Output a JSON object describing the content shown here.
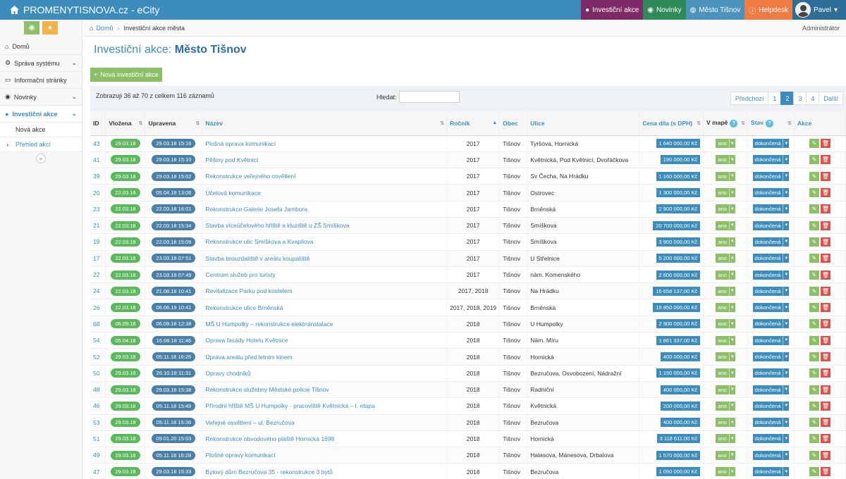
{
  "app": {
    "title": "PROMENYTISNOVA.cz - eCity"
  },
  "topnav": {
    "investicni": "Investiční akce",
    "novinky": "Novinky",
    "mesto": "Město Tišnov",
    "helpdesk": "Helpdesk",
    "user": "Pavel"
  },
  "breadcrumb": {
    "home": "Domů",
    "current": "Investiční akce města",
    "role": "Administrátor"
  },
  "sidebar": {
    "items": [
      {
        "label": "Domů",
        "icon": "home-icon"
      },
      {
        "label": "Správa systému",
        "icon": "gears-icon"
      },
      {
        "label": "Informační stránky",
        "icon": "monitor-icon"
      },
      {
        "label": "Novinky",
        "icon": "rss-icon"
      },
      {
        "label": "Investiční akce",
        "icon": "map-marker-icon"
      }
    ],
    "subitems": [
      "Nová akce",
      "Přehled akcí"
    ]
  },
  "page": {
    "title_prefix": "Investiční akce:",
    "title_city": "Město Tišnov",
    "add_button": "Nová investiční akce"
  },
  "table_controls": {
    "info": "Zobrazuji 36 až 70 z celkem 116 záznamů",
    "search_label": "Hledat:",
    "search_value": "",
    "pager": {
      "prev": "Předchozí",
      "pages": [
        "1",
        "2",
        "3",
        "4"
      ],
      "current": "2",
      "next": "Další"
    }
  },
  "columns": [
    "ID",
    "Vložena",
    "Upravena",
    "Název",
    "Ročník",
    "Obec",
    "Ulice",
    "Cena díla (s DPH)",
    "V mapě",
    "Stav",
    "Akce"
  ],
  "rows": [
    {
      "id": "43",
      "vlozena": "29.03.18",
      "upravena": "29.03.18 15:16",
      "nazev": "Plošná oprava komunikací",
      "rocnik": "2017",
      "obec": "Tišnov",
      "ulice": "Tyršova, Hornická",
      "cena": "1 640 000,00 Kč",
      "mapa": "ano",
      "stav": "dokončená"
    },
    {
      "id": "41",
      "vlozena": "29.03.18",
      "upravena": "29.03.18 15:10",
      "nazev": "Pěšiny pod Květnicí",
      "rocnik": "2017",
      "obec": "Tišnov",
      "ulice": "Květnická, Pod Květnicí, Dvořáčkova",
      "cena": "190 000,00 Kč",
      "mapa": "ano",
      "stav": "dokončená"
    },
    {
      "id": "39",
      "vlozena": "29.03.18",
      "upravena": "29.03.18 15:02",
      "nazev": "Rekonstrukce veřejného osvětlení",
      "rocnik": "2017",
      "obec": "Tišnov",
      "ulice": "Sv Čecha, Na Hrádku",
      "cena": "1 160 000,00 Kč",
      "mapa": "ano",
      "stav": "dokončená"
    },
    {
      "id": "20",
      "vlozena": "22.03.18",
      "upravena": "05.04.18 13:06",
      "nazev": "Účelová komunikace",
      "rocnik": "2017",
      "obec": "Tišnov",
      "ulice": "Ostrovec",
      "cena": "1 300 000,00 Kč",
      "mapa": "ano",
      "stav": "dokončená"
    },
    {
      "id": "23",
      "vlozena": "22.03.18",
      "upravena": "22.03.18 16:01",
      "nazev": "Rekonstrukce Galerie Josefa Jambora",
      "rocnik": "2017",
      "obec": "Tišnov",
      "ulice": "Brněnská",
      "cena": "2 900 000,00 Kč",
      "mapa": "ano",
      "stav": "dokončená"
    },
    {
      "id": "21",
      "vlozena": "22.03.18",
      "upravena": "22.03.18 15:34",
      "nazev": "Stavba víceúčelového hřiště a kluziště u ZŠ Smíškova",
      "rocnik": "2017",
      "obec": "Tišnov",
      "ulice": "Smíškova",
      "cena": "20 700 000,00 Kč",
      "mapa": "ano",
      "stav": "dokončená"
    },
    {
      "id": "19",
      "vlozena": "22.03.18",
      "upravena": "22.03.18 15:09",
      "nazev": "Rekonstrukce ulic Smíškova a Kvapilova",
      "rocnik": "2017",
      "obec": "Tišnov",
      "ulice": "Smíškova",
      "cena": "3 900 000,00 Kč",
      "mapa": "ano",
      "stav": "dokončená"
    },
    {
      "id": "17",
      "vlozena": "22.03.18",
      "upravena": "23.03.18 07:51",
      "nazev": "Stavba brouzdaliště v areálu koupaliště",
      "rocnik": "2017",
      "obec": "Tišnov",
      "ulice": "U Střelnice",
      "cena": "5 200 000,00 Kč",
      "mapa": "ano",
      "stav": "dokončená"
    },
    {
      "id": "22",
      "vlozena": "22.03.18",
      "upravena": "23.03.18 07:49",
      "nazev": "Centrum služeb pro turisty",
      "rocnik": "2017",
      "obec": "Tišnov",
      "ulice": "nám. Komenského",
      "cena": "2 600 000,00 Kč",
      "mapa": "ano",
      "stav": "dokončená"
    },
    {
      "id": "24",
      "vlozena": "22.03.18",
      "upravena": "21.08.18 10:41",
      "nazev": "Revitalizace Parku pod kostelem",
      "rocnik": "2017, 2018",
      "obec": "Tišnov",
      "ulice": "Na Hrádku",
      "cena": "15 658 137,00 Kč",
      "mapa": "ano",
      "stav": "dokončená"
    },
    {
      "id": "26",
      "vlozena": "22.03.18",
      "upravena": "06.06.19 10:41",
      "nazev": "Rekonstrukce ulice Brněnská",
      "rocnik": "2017, 2018, 2019",
      "obec": "Tišnov",
      "ulice": "Brněnská",
      "cena": "19 850 000,00 Kč",
      "mapa": "ano",
      "stav": "dokončená"
    },
    {
      "id": "68",
      "vlozena": "06.09.18",
      "upravena": "06.09.18 12:38",
      "nazev": "MŠ U Humpolky – rekonstrukce elektroinstalace",
      "rocnik": "2018",
      "obec": "Tišnov",
      "ulice": "U Humpolky",
      "cena": "2 900 000,00 Kč",
      "mapa": "ano",
      "stav": "dokončená"
    },
    {
      "id": "54",
      "vlozena": "05.04.18",
      "upravena": "16.08.18 11:46",
      "nazev": "Oprava fasády Hotelu Květnice",
      "rocnik": "2018",
      "obec": "Tišnov",
      "ulice": "Nám. Míru",
      "cena": "1 861 337,00 Kč",
      "mapa": "ano",
      "stav": "dokončená"
    },
    {
      "id": "52",
      "vlozena": "29.03.18",
      "upravena": "05.11.18 16:26",
      "nazev": "Úprava areálu před letním kinem",
      "rocnik": "2018",
      "obec": "Tišnov",
      "ulice": "Hornická",
      "cena": "400 000,00 Kč",
      "mapa": "ano",
      "stav": "dokončená"
    },
    {
      "id": "50",
      "vlozena": "29.03.18",
      "upravena": "26.10.18 11:31",
      "nazev": "Opravy chodníků",
      "rocnik": "2018",
      "obec": "Tišnov",
      "ulice": "Bezručova, Osvobození, Nádražní",
      "cena": "1 150 000,00 Kč",
      "mapa": "ano",
      "stav": "dokončená"
    },
    {
      "id": "48",
      "vlozena": "29.03.18",
      "upravena": "29.03.18 15:38",
      "nazev": "Rekonstrukce služebny Městské policie Tišnov",
      "rocnik": "2018",
      "obec": "Tišnov",
      "ulice": "Radniční",
      "cena": "400 000,00 Kč",
      "mapa": "ano",
      "stav": "dokončená"
    },
    {
      "id": "46",
      "vlozena": "29.03.18",
      "upravena": "05.11.18 15:49",
      "nazev": "Přírodní hřiště MŠ U Humpolky - pracoviště Květnická – I. etapa",
      "rocnik": "2018",
      "obec": "Tišnov",
      "ulice": "Květnická",
      "cena": "200 000,00 Kč",
      "mapa": "ano",
      "stav": "dokončená"
    },
    {
      "id": "53",
      "vlozena": "29.03.18",
      "upravena": "05.11.18 15:38",
      "nazev": "Veřejné osvětlení – ul. Bezručova",
      "rocnik": "2018",
      "obec": "Tišnov",
      "ulice": "Bezručova",
      "cena": "400 000,00 Kč",
      "mapa": "ano",
      "stav": "dokončená"
    },
    {
      "id": "51",
      "vlozena": "29.03.18",
      "upravena": "09.01.20 15:03",
      "nazev": "Rekonstrukce obvodového pláště Hornická 1698",
      "rocnik": "2018",
      "obec": "Tišnov",
      "ulice": "Hornická",
      "cena": "3 118 611,00 Kč",
      "mapa": "ano",
      "stav": "dokončená"
    },
    {
      "id": "49",
      "vlozena": "29.03.18",
      "upravena": "05.11.18 16:28",
      "nazev": "Plošné opravy komunikací",
      "rocnik": "2018",
      "obec": "Tišnov",
      "ulice": "Halasova, Mánesova, Drbalova",
      "cena": "1 570 000,00 Kč",
      "mapa": "ano",
      "stav": "dokončená"
    },
    {
      "id": "47",
      "vlozena": "29.03.18",
      "upravena": "29.03.18 15:33",
      "nazev": "Bytový dům Bezručova 35 - rekonstrukce 3 bytů",
      "rocnik": "2018",
      "obec": "Tišnov",
      "ulice": "Bezručova",
      "cena": "1 050 000,00 Kč",
      "mapa": "ano",
      "stav": "dokončená"
    }
  ],
  "colors": {
    "topbar": "#3c8dbc",
    "investicni": "#7f2a68",
    "novinky": "#2e8b57",
    "mesto": "#4c93bd",
    "helpdesk": "#f07c45",
    "green": "#8cc068",
    "red": "#d9534f"
  }
}
